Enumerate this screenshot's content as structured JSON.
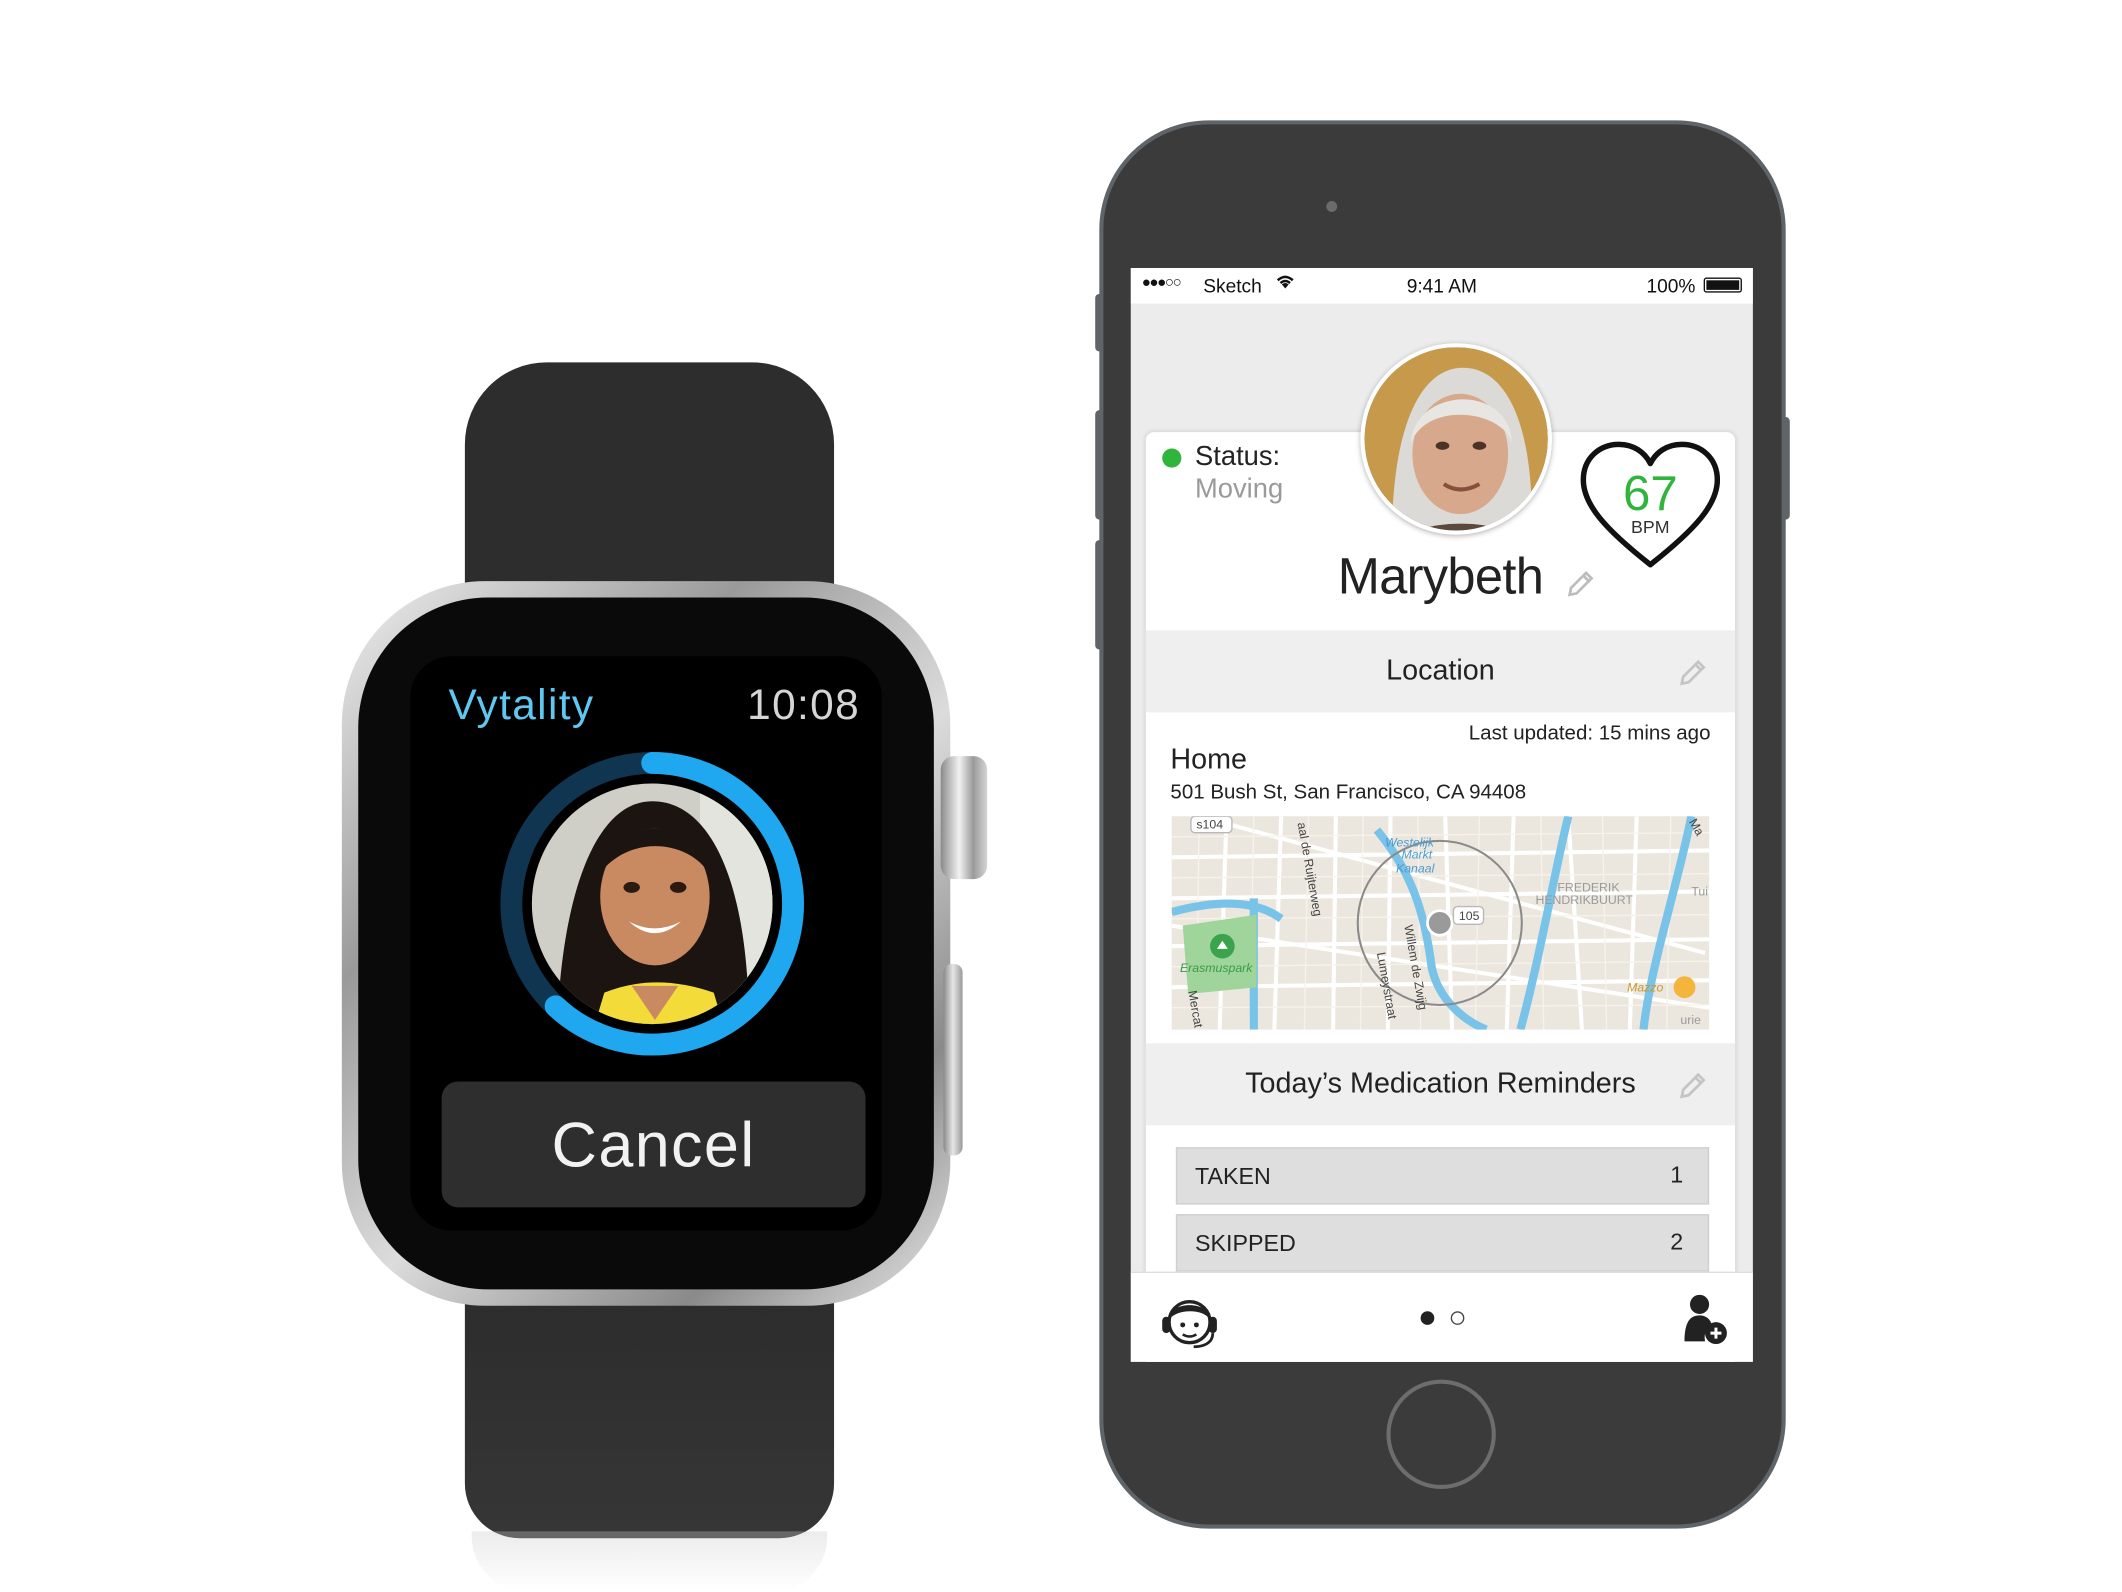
{
  "watch": {
    "app_name": "Vytality",
    "time": "10:08",
    "cancel_label": "Cancel",
    "progress": 0.62,
    "accent_color": "#1fa8ef"
  },
  "phone": {
    "statusbar": {
      "signal": "●●●○○",
      "carrier": "Sketch",
      "time": "9:41 AM",
      "battery": "100%"
    },
    "profile": {
      "status_label": "Status:",
      "status_value": "Moving",
      "name": "Marybeth",
      "bpm_value": "67",
      "bpm_unit": "BPM",
      "status_color": "#2fb53c"
    },
    "location": {
      "header": "Location",
      "last_updated": "Last updated: 15 mins ago",
      "place": "Home",
      "address": "501 Bush St, San Francisco, CA 94408",
      "map_labels": {
        "s104": "s104",
        "rujter": "aal de Ruijterweg",
        "westelijk": "Westelijk",
        "markt": "Markt",
        "kanaal": "Kanaal",
        "frederik": "FREDERIK",
        "hendrik": "HENDRIKBUURT",
        "r105": "105",
        "erasmus": "Erasmuspark",
        "willem": "Willem de Zwijg",
        "lumey": "Lumeystraat",
        "mazzo": "Mazzo",
        "mercat": "Mercat",
        "ma": "Ma",
        "tui": "Tui",
        "urie": "urie"
      }
    },
    "medication": {
      "header": "Today’s Medication Reminders",
      "rows": [
        {
          "label": "TAKEN",
          "count": "1"
        },
        {
          "label": "SKIPPED",
          "count": "2"
        }
      ]
    },
    "page_indicator": {
      "pages": 2,
      "current": 1
    }
  }
}
